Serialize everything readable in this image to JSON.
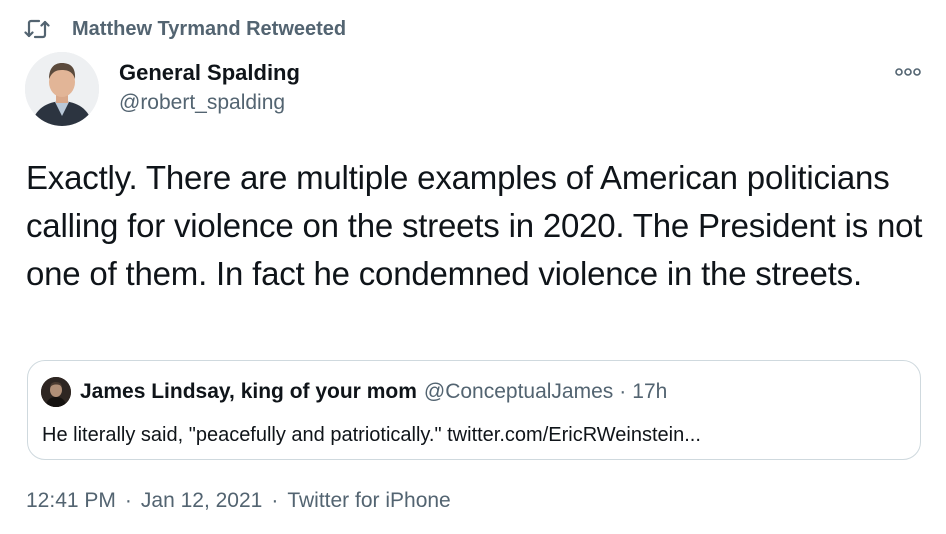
{
  "retweet": {
    "label": "Matthew Tyrmand Retweeted",
    "icon": "retweet-icon"
  },
  "author": {
    "name": "General Spalding",
    "handle": "@robert_spalding",
    "avatar_icon": "avatar-photo"
  },
  "more": {
    "icon": "more-horizontal-icon"
  },
  "tweet": {
    "text": "Exactly. There are multiple examples of American politicians calling for violence on the streets in 2020. The President is not one of them. In fact he condemned violence in the streets."
  },
  "quote": {
    "name": "James Lindsay, king of your mom",
    "handle": "@ConceptualJames",
    "separator": "·",
    "time": "17h",
    "text": "He literally said, \"peacefully and patriotically.\" twitter.com/EricRWeinstein..."
  },
  "meta": {
    "time": "12:41 PM",
    "separator1": "·",
    "date": "Jan 12, 2021",
    "separator2": "·",
    "source": "Twitter for iPhone"
  },
  "colors": {
    "text_primary": "#0f1419",
    "text_secondary": "#536471",
    "border": "#cfd9de"
  }
}
